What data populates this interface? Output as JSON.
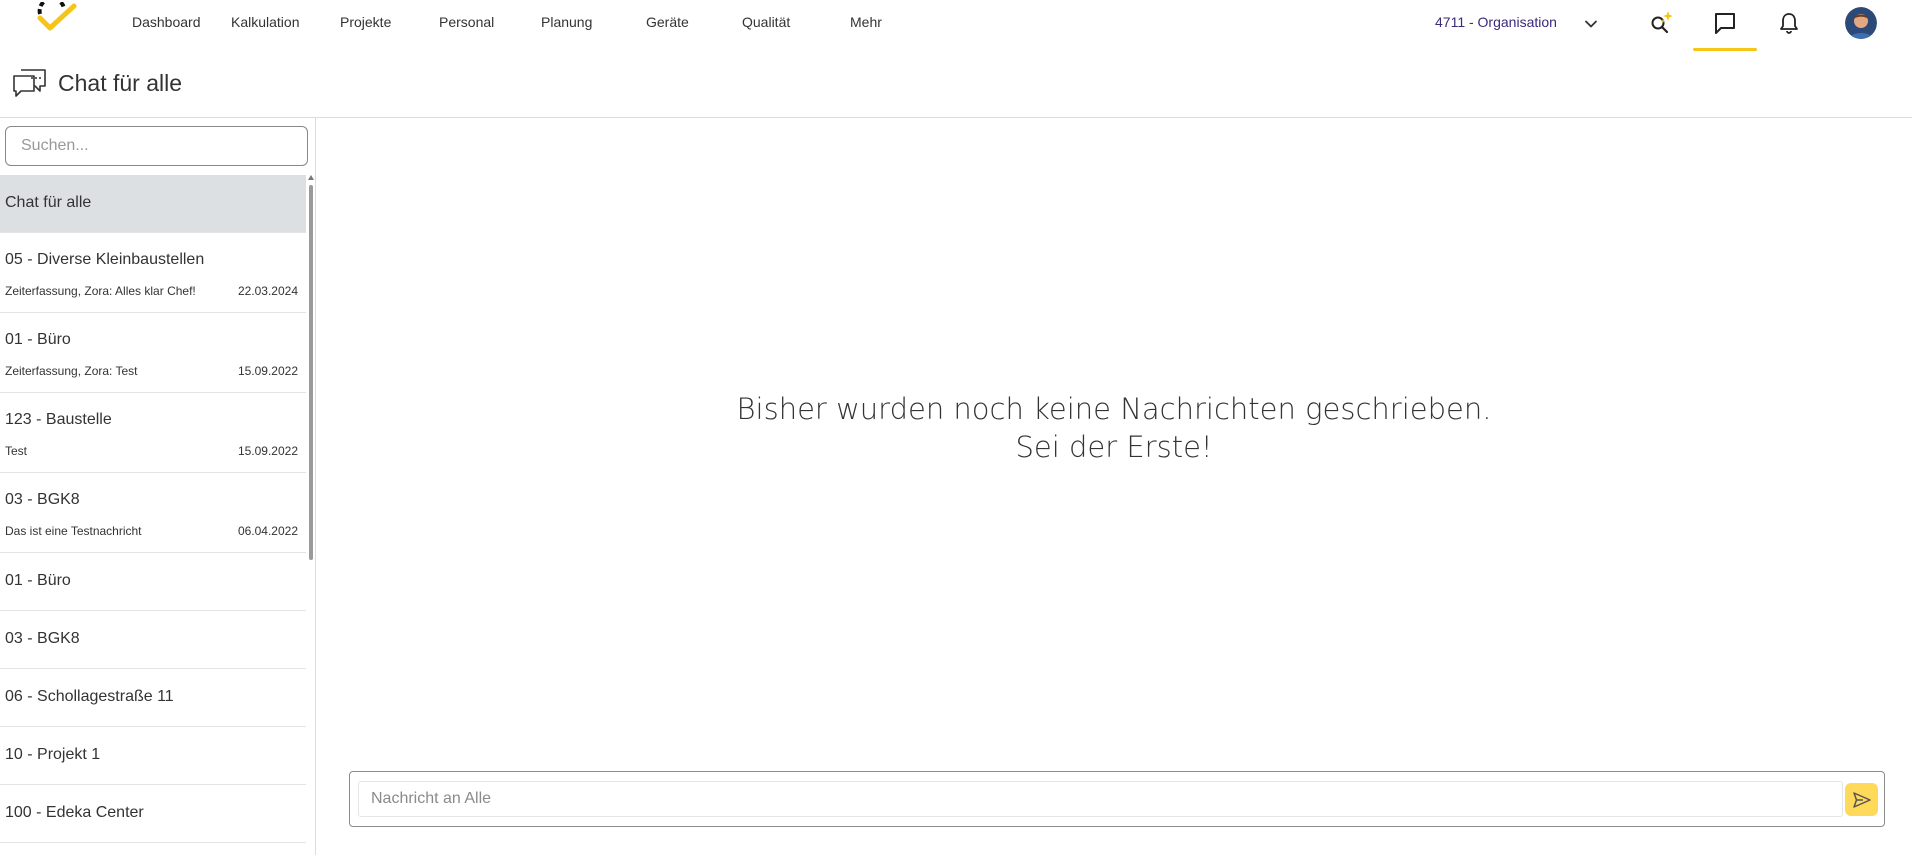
{
  "nav": {
    "items": [
      "Dashboard",
      "Kalkulation",
      "Projekte",
      "Personal",
      "Planung",
      "Geräte",
      "Qualität",
      "Mehr"
    ],
    "organisation": "4711 - Organisation"
  },
  "icons": {
    "logo": "checkmark-logo",
    "search": "sparkle-search-icon",
    "chat": "chat-bubble-icon",
    "notifications": "bell-icon",
    "profile": "avatar"
  },
  "page": {
    "title": "Chat für alle"
  },
  "sidebar": {
    "search_placeholder": "Suchen...",
    "chats": [
      {
        "title": "Chat für alle",
        "preview": "",
        "date": "",
        "active": true
      },
      {
        "title": "05 - Diverse Kleinbaustellen",
        "preview": "Zeiterfassung, Zora: Alles klar Chef!",
        "date": "22.03.2024"
      },
      {
        "title": "01 - Büro",
        "preview": "Zeiterfassung, Zora: Test",
        "date": "15.09.2022"
      },
      {
        "title": "123 - Baustelle",
        "preview": "Test",
        "date": "15.09.2022"
      },
      {
        "title": "03 - BGK8",
        "preview": "Das ist eine Testnachricht",
        "date": "06.04.2022"
      },
      {
        "title": "01 - Büro",
        "preview": "",
        "date": ""
      },
      {
        "title": "03 - BGK8",
        "preview": "",
        "date": ""
      },
      {
        "title": "06 - Schollagestraße 11",
        "preview": "",
        "date": ""
      },
      {
        "title": "10 - Projekt 1",
        "preview": "",
        "date": ""
      },
      {
        "title": "100 - Edeka Center",
        "preview": "",
        "date": ""
      }
    ]
  },
  "main": {
    "empty_line1": "Bisher wurden noch keine Nachrichten geschrieben.",
    "empty_line2": "Sei der Erste!",
    "message_placeholder": "Nachricht an Alle"
  },
  "colors": {
    "accent": "#f5c518",
    "send_button": "#ffd95a",
    "organisation_text": "#3b2a7a",
    "active_chat_bg": "#dde0e3"
  }
}
